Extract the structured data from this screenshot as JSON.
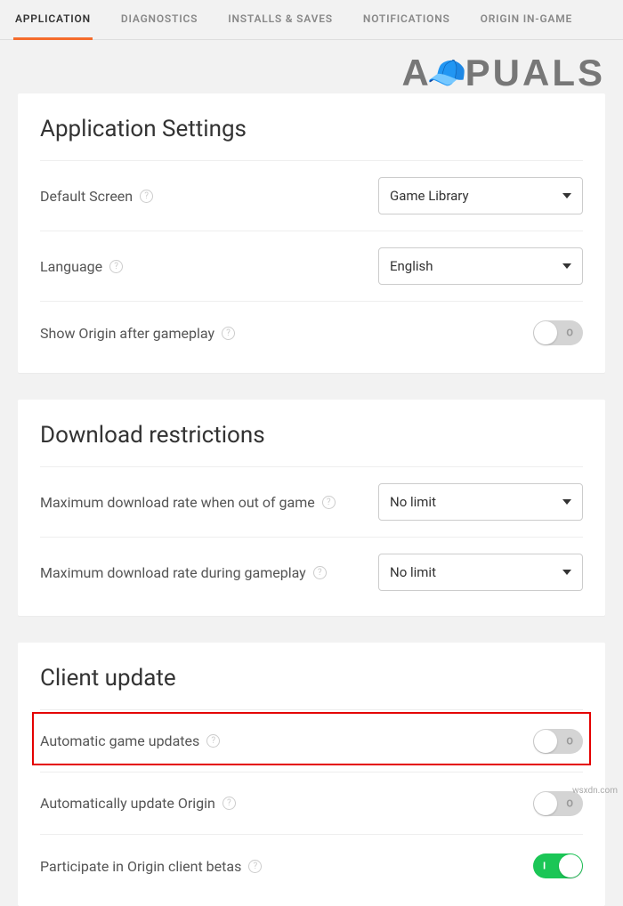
{
  "tabs": {
    "application": "APPLICATION",
    "diagnostics": "DIAGNOSTICS",
    "installs": "INSTALLS & SAVES",
    "notifications": "NOTIFICATIONS",
    "origin_ingame": "ORIGIN IN-GAME"
  },
  "watermark": {
    "left": "A",
    "right": "PUALS"
  },
  "app_settings": {
    "title": "Application Settings",
    "default_screen": {
      "label": "Default Screen",
      "value": "Game Library"
    },
    "language": {
      "label": "Language",
      "value": "English"
    },
    "show_after_gameplay": {
      "label": "Show Origin after gameplay",
      "value": "O",
      "state": "off"
    }
  },
  "download": {
    "title": "Download restrictions",
    "out_of_game": {
      "label": "Maximum download rate when out of game",
      "value": "No limit"
    },
    "during_gameplay": {
      "label": "Maximum download rate during gameplay",
      "value": "No limit"
    }
  },
  "client_update": {
    "title": "Client update",
    "auto_game": {
      "label": "Automatic game updates",
      "value": "O",
      "state": "off"
    },
    "auto_origin": {
      "label": "Automatically update Origin",
      "value": "O",
      "state": "off"
    },
    "betas": {
      "label": "Participate in Origin client betas",
      "value": "I",
      "state": "on"
    }
  },
  "footer": "wsxdn.com"
}
